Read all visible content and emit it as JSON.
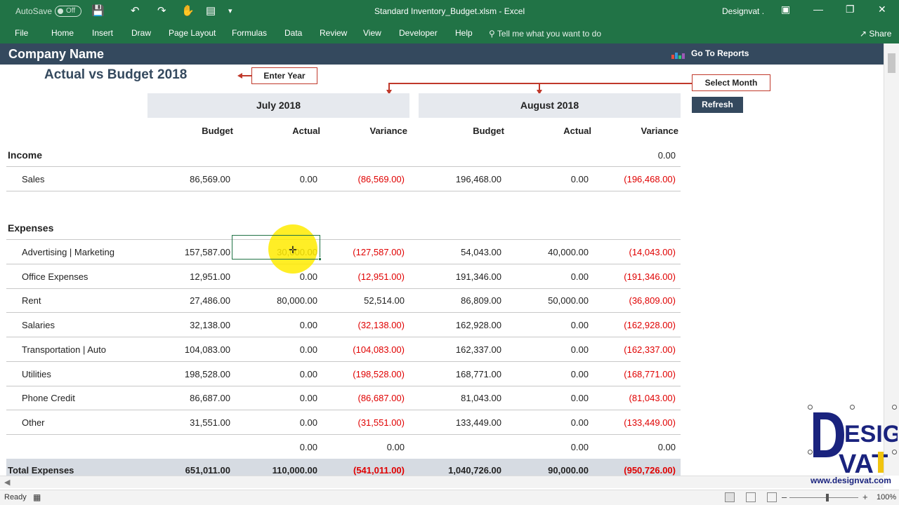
{
  "titlebar": {
    "autosave_label": "AutoSave",
    "autosave_state": "Off",
    "doc_title": "Standard Inventory_Budget.xlsm  -  Excel",
    "user": "Designvat ."
  },
  "ribbon": {
    "tabs": [
      "File",
      "Home",
      "Insert",
      "Draw",
      "Page Layout",
      "Formulas",
      "Data",
      "Review",
      "View",
      "Developer",
      "Help"
    ],
    "tell_me": "Tell me what you want to do",
    "share": "Share"
  },
  "sheet": {
    "company": "Company Name",
    "go_to_reports": "Go To Reports",
    "title": "Actual vs Budget",
    "year": "2018",
    "enter_year": "Enter Year",
    "select_month": "Select Month",
    "refresh": "Refresh",
    "months": [
      "July 2018",
      "August 2018"
    ],
    "column_headers": [
      "Budget",
      "Actual",
      "Variance",
      "Budget",
      "Actual",
      "Variance"
    ],
    "income_label": "Income",
    "income_header_values": [
      "",
      "",
      "",
      "",
      "",
      "0.00"
    ],
    "income_rows": [
      {
        "label": "Sales",
        "values": [
          "86,569.00",
          "0.00",
          "(86,569.00)",
          "196,468.00",
          "0.00",
          "(196,468.00)"
        ]
      }
    ],
    "expenses_label": "Expenses",
    "expense_rows": [
      {
        "label": "Advertising | Marketing",
        "values": [
          "157,587.00",
          "30,000.00",
          "(127,587.00)",
          "54,043.00",
          "40,000.00",
          "(14,043.00)"
        ]
      },
      {
        "label": "Office Expenses",
        "values": [
          "12,951.00",
          "0.00",
          "(12,951.00)",
          "191,346.00",
          "0.00",
          "(191,346.00)"
        ]
      },
      {
        "label": "Rent",
        "values": [
          "27,486.00",
          "80,000.00",
          "52,514.00",
          "86,809.00",
          "50,000.00",
          "(36,809.00)"
        ]
      },
      {
        "label": "Salaries",
        "values": [
          "32,138.00",
          "0.00",
          "(32,138.00)",
          "162,928.00",
          "0.00",
          "(162,928.00)"
        ]
      },
      {
        "label": "Transportation | Auto",
        "values": [
          "104,083.00",
          "0.00",
          "(104,083.00)",
          "162,337.00",
          "0.00",
          "(162,337.00)"
        ]
      },
      {
        "label": "Utilities",
        "values": [
          "198,528.00",
          "0.00",
          "(198,528.00)",
          "168,771.00",
          "0.00",
          "(168,771.00)"
        ]
      },
      {
        "label": "Phone Credit",
        "values": [
          "86,687.00",
          "0.00",
          "(86,687.00)",
          "81,043.00",
          "0.00",
          "(81,043.00)"
        ]
      },
      {
        "label": "Other",
        "values": [
          "31,551.00",
          "0.00",
          "(31,551.00)",
          "133,449.00",
          "0.00",
          "(133,449.00)"
        ]
      },
      {
        "label": "",
        "values": [
          "",
          "0.00",
          "0.00",
          "",
          "0.00",
          "0.00"
        ]
      }
    ],
    "total_label": "Total Expenses",
    "total_values": [
      "651,011.00",
      "110,000.00",
      "(541,011.00)",
      "1,040,726.00",
      "90,000.00",
      "(950,726.00)"
    ]
  },
  "statusbar": {
    "ready": "Ready",
    "zoom": "100%"
  },
  "logo": {
    "text": "www.designvat.com",
    "mark": "DESIGN VAT"
  },
  "colors": {
    "excel_green": "#217346",
    "header_navy": "#34495e",
    "negative_red": "#e00000",
    "month_band": "#e6e9ee"
  }
}
